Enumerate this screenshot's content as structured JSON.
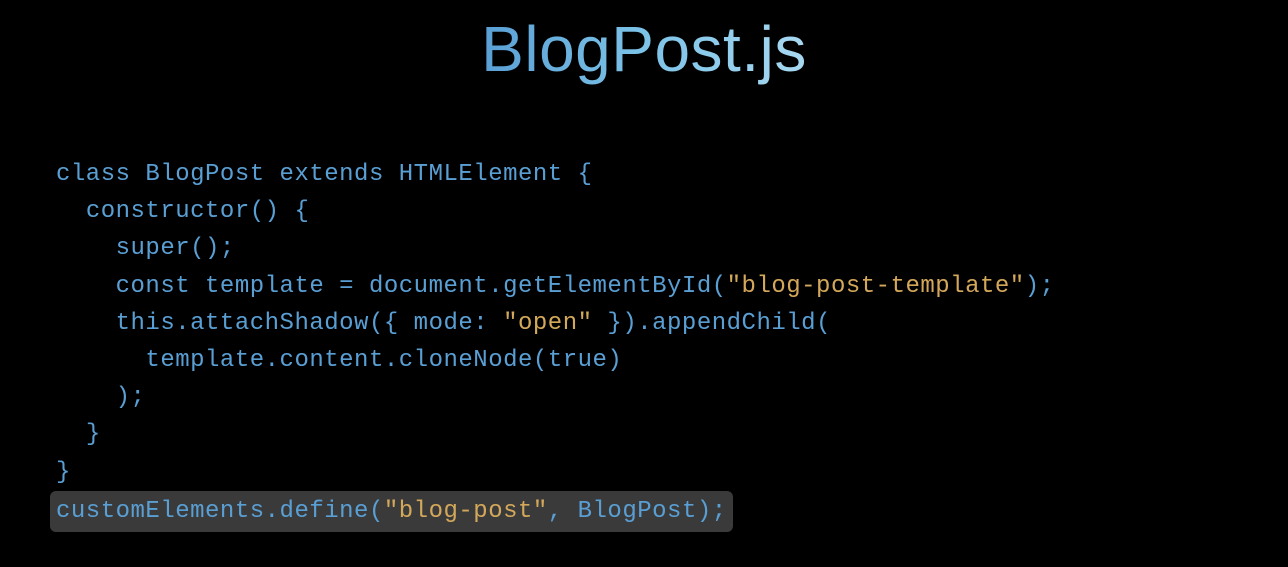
{
  "title": "BlogPost.js",
  "code": {
    "line1": {
      "kw_class": "class",
      "classname": "BlogPost",
      "kw_extends": "extends",
      "superclass": "HTMLElement",
      "brace": "{"
    },
    "line2": {
      "fn": "constructor",
      "parens": "()",
      "brace": "{"
    },
    "line3": {
      "kw_super": "super",
      "call": "();"
    },
    "line4": {
      "kw_const": "const",
      "varname": "template",
      "eq": "=",
      "obj": "document",
      "dot1": ".",
      "method": "getElementById",
      "open": "(",
      "str": "\"blog-post-template\"",
      "close": ");"
    },
    "line5": {
      "this": "this",
      "dot1": ".",
      "method1": "attachShadow",
      "open1": "({ ",
      "key": "mode",
      "colon": ": ",
      "str": "\"open\"",
      "close1": " }).",
      "method2": "appendChild",
      "open2": "("
    },
    "line6": {
      "var": "template",
      "dot1": ".",
      "prop": "content",
      "dot2": ".",
      "method": "cloneNode",
      "open": "(",
      "bool": "true",
      "close": ")"
    },
    "line7": {
      "close": ");"
    },
    "line8": {
      "brace": "}"
    },
    "line9": {
      "brace": "}"
    },
    "line10": {
      "obj": "customElements",
      "dot": ".",
      "method": "define",
      "open": "(",
      "str": "\"blog-post\"",
      "comma": ", ",
      "cls": "BlogPost",
      "close": ");"
    }
  }
}
